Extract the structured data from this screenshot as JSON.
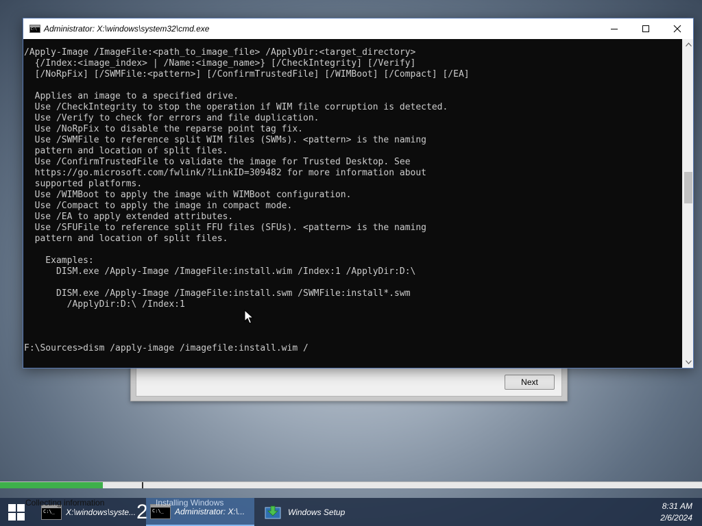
{
  "setup_window": {
    "next_label": "Next"
  },
  "cmd_window": {
    "title": "Administrator: X:\\windows\\system32\\cmd.exe",
    "console_lines": [
      "/Apply-Image /ImageFile:<path_to_image_file> /ApplyDir:<target_directory>",
      "  {/Index:<image_index> | /Name:<image_name>} [/CheckIntegrity] [/Verify]",
      "  [/NoRpFix] [/SWMFile:<pattern>] [/ConfirmTrustedFile] [/WIMBoot] [/Compact] [/EA]",
      "",
      "  Applies an image to a specified drive.",
      "  Use /CheckIntegrity to stop the operation if WIM file corruption is detected.",
      "  Use /Verify to check for errors and file duplication.",
      "  Use /NoRpFix to disable the reparse point tag fix.",
      "  Use /SWMFile to reference split WIM files (SWMs). <pattern> is the naming",
      "  pattern and location of split files.",
      "  Use /ConfirmTrustedFile to validate the image for Trusted Desktop. See",
      "  https://go.microsoft.com/fwlink/?LinkID=309482 for more information about",
      "  supported platforms.",
      "  Use /WIMBoot to apply the image with WIMBoot configuration.",
      "  Use /Compact to apply the image in compact mode.",
      "  Use /EA to apply extended attributes.",
      "  Use /SFUFile to reference split FFU files (SFUs). <pattern> is the naming",
      "  pattern and location of split files.",
      "",
      "    Examples:",
      "      DISM.exe /Apply-Image /ImageFile:install.wim /Index:1 /ApplyDir:D:\\",
      "",
      "      DISM.exe /Apply-Image /ImageFile:install.swm /SWMFile:install*.swm",
      "        /ApplyDir:D:\\ /Index:1",
      "",
      "",
      "",
      "F:\\Sources>dism /apply-image /imagefile:install.wim /"
    ]
  },
  "setup_progress": {
    "completed_fraction": 0.146,
    "step_1_label": "Collecting information",
    "step_2_label": "Installing Windows"
  },
  "taskbar": {
    "items": [
      {
        "label": "X:\\windows\\syste...",
        "icon": "cmd-icon"
      },
      {
        "label": "Administrator: X:\\...",
        "icon": "cmd-icon"
      },
      {
        "label": "Windows Setup",
        "icon": "setup-icon"
      }
    ],
    "group_count": "2",
    "clock_time": "8:31 AM",
    "clock_date": "2/6/2024"
  },
  "colors": {
    "console_bg": "#0c0c0c",
    "console_text": "#cccccc",
    "progress_green": "#3eb04b"
  }
}
